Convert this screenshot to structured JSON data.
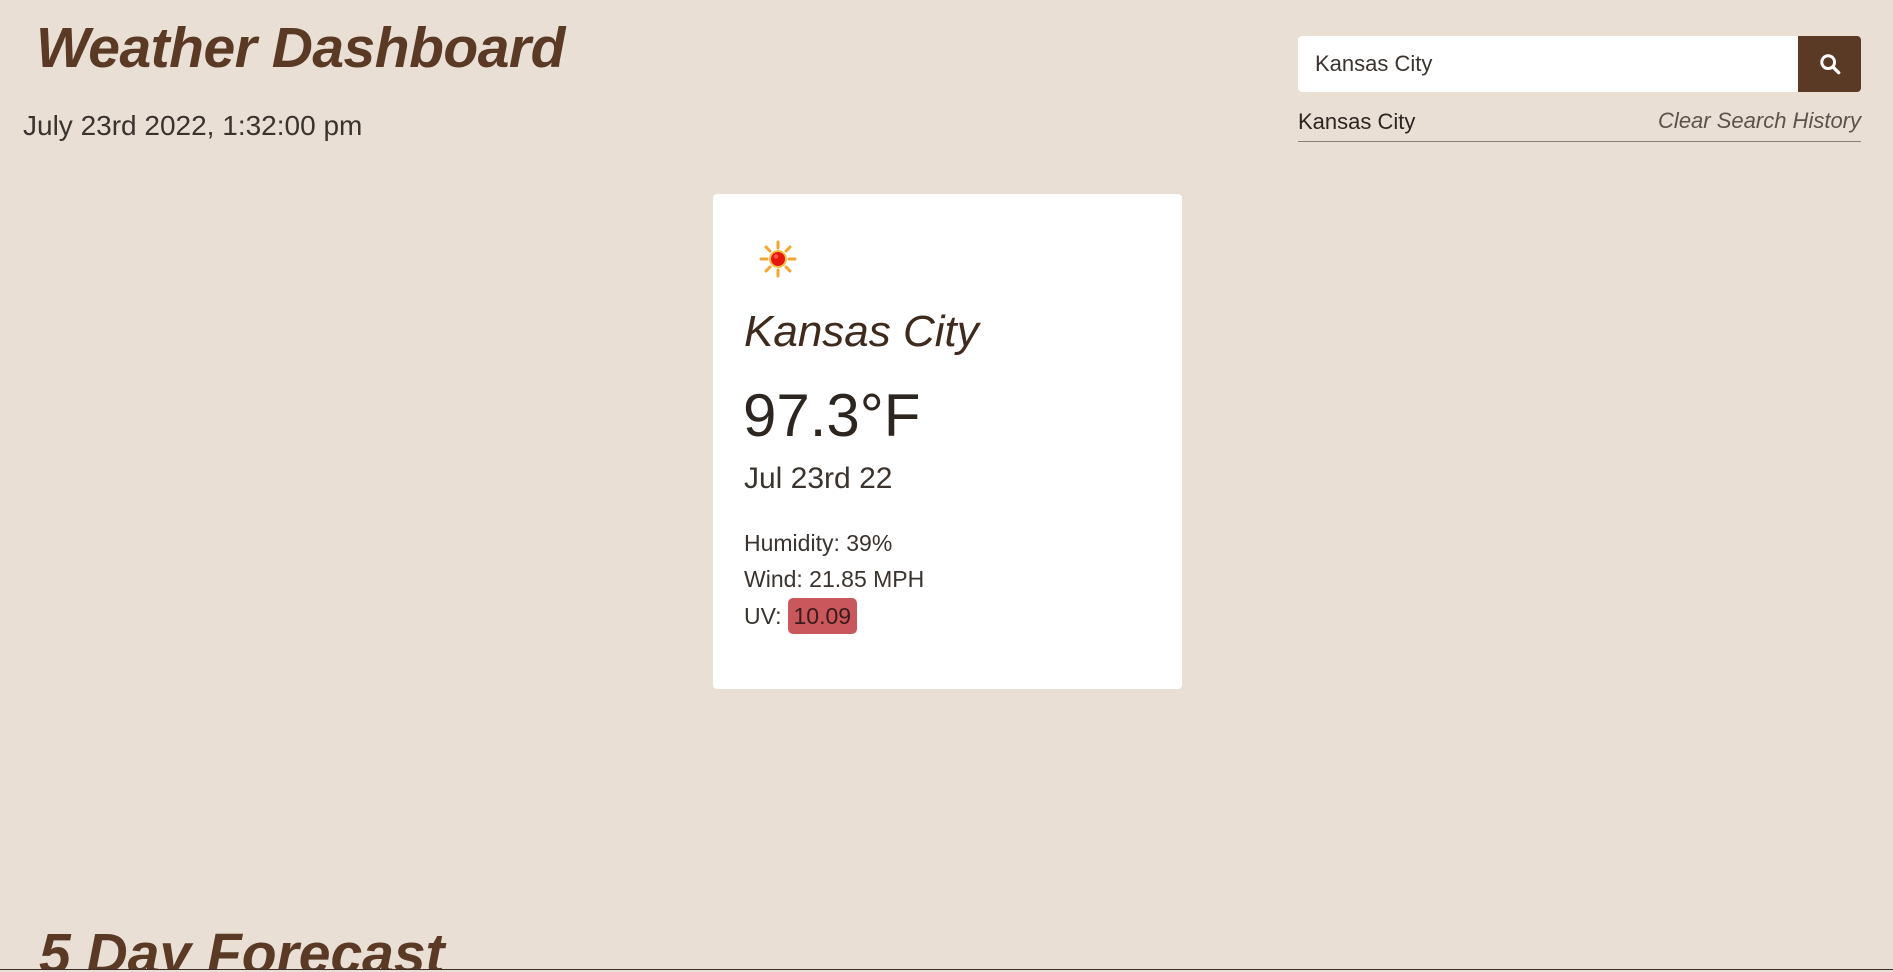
{
  "header": {
    "title": "Weather Dashboard",
    "datetime": "July 23rd 2022, 1:32:00 pm"
  },
  "search": {
    "value": "Kansas City",
    "button_icon": "search-icon"
  },
  "history": {
    "items": [
      "Kansas City"
    ],
    "clear_label": "Clear Search History"
  },
  "current": {
    "icon": "sun-icon",
    "city": "Kansas City",
    "temperature": "97.3°F",
    "date": "Jul 23rd 22",
    "humidity": "Humidity: 39%",
    "wind": "Wind: 21.85 MPH",
    "uv_label": "UV:",
    "uv_value": "10.09"
  },
  "forecast": {
    "title": "5 Day Forecast"
  },
  "colors": {
    "background": "#e9dfd5",
    "brand": "#5a3925",
    "uv_severe": "#c9575b"
  }
}
